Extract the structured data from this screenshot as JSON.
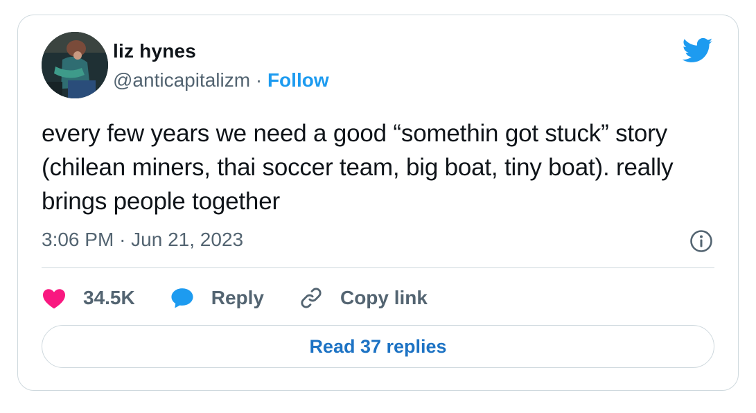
{
  "author": {
    "name": "liz hynes",
    "handle": "@anticapitalizm",
    "separator": "·",
    "follow_label": "Follow"
  },
  "tweet": {
    "text": "every few years we need a good “somethin got stuck” story (chilean miners, thai soccer team, big boat, tiny boat). really brings people together",
    "time": "3:06 PM",
    "date_separator": "·",
    "date": "Jun 21, 2023"
  },
  "actions": {
    "like_count": "34.5K",
    "reply_label": "Reply",
    "copy_label": "Copy link"
  },
  "read_replies_label": "Read 37 replies",
  "colors": {
    "brand_blue": "#1d9bf0",
    "like_pink": "#f91880",
    "text_primary": "#0f1419",
    "text_secondary": "#536471",
    "border": "#cfd9de"
  },
  "icons": {
    "brand": "twitter-bird-icon",
    "info": "info-icon",
    "like": "heart-icon",
    "reply": "speech-bubble-icon",
    "copy": "link-icon"
  }
}
